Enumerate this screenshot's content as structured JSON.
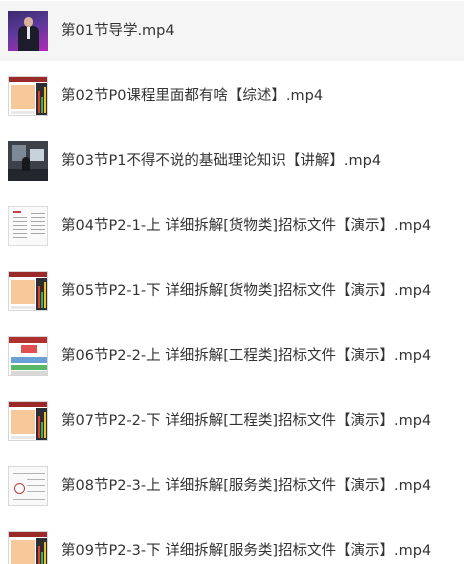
{
  "files": [
    {
      "name": "第01节导学.mp4",
      "thumbnail": "presenter-thumbnail"
    },
    {
      "name": "第02节P0课程里面都有啥【综述】.mp4",
      "thumbnail": "chart-thumbnail"
    },
    {
      "name": "第03节P1不得不说的基础理论知识【讲解】.mp4",
      "thumbnail": "room-thumbnail"
    },
    {
      "name": "第04节P2-1-上 详细拆解[货物类]招标文件【演示】.mp4",
      "thumbnail": "document-thumbnail"
    },
    {
      "name": "第05节P2-1-下 详细拆解[货物类]招标文件【演示】.mp4",
      "thumbnail": "chart-thumbnail"
    },
    {
      "name": "第06节P2-2-上 详细拆解[工程类]招标文件【演示】.mp4",
      "thumbnail": "spreadsheet-thumbnail"
    },
    {
      "name": "第07节P2-2-下 详细拆解[工程类]招标文件【演示】.mp4",
      "thumbnail": "chart-thumbnail"
    },
    {
      "name": "第08节P2-3-上 详细拆解[服务类]招标文件【演示】.mp4",
      "thumbnail": "sheet-thumbnail"
    },
    {
      "name": "第09节P2-3-下 详细拆解[服务类]招标文件【演示】.mp4",
      "thumbnail": "chart-thumbnail"
    }
  ],
  "selected_index": 0,
  "colors": {
    "selected_row_bg": "#f5f5f5",
    "text": "#333333"
  }
}
